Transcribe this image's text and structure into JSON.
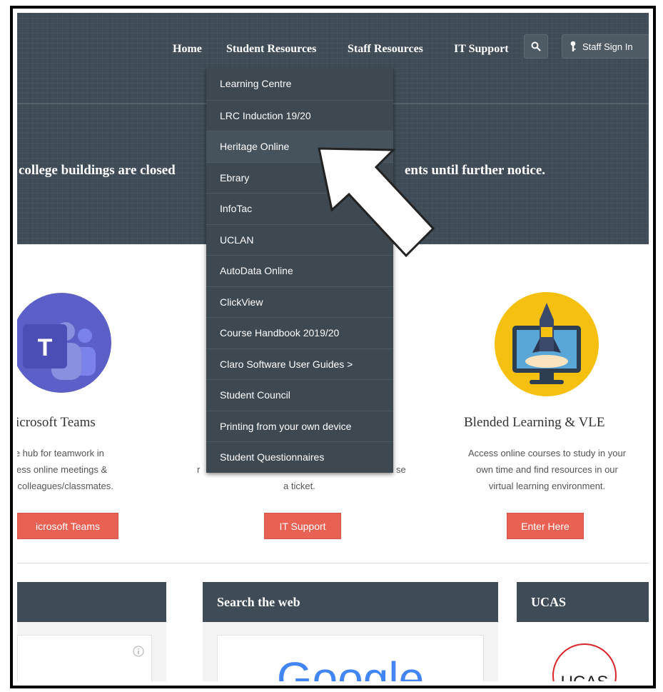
{
  "nav": {
    "items": [
      "Home",
      "Student Resources",
      "Staff Resources",
      "IT Support"
    ],
    "signin_label": "Staff Sign In"
  },
  "hero": {
    "notice_left": "college buildings are closed",
    "notice_right": "ents until further notice."
  },
  "dropdown": {
    "items": [
      "Learning Centre",
      "LRC Induction 19/20",
      "Heritage Online",
      "Ebrary",
      "InfoTac",
      "UCLAN",
      "AutoData Online",
      "ClickView",
      "Course Handbook 2019/20",
      "Claro Software User Guides >",
      "Student Council",
      "Printing from your own device",
      "Student Questionnaires"
    ],
    "highlighted_index": 2
  },
  "cards": {
    "teams": {
      "title": "icrosoft Teams",
      "lines": [
        "the hub for teamwork in",
        "ccess online meetings &",
        "th colleagues/classmates."
      ],
      "button": "icrosoft Teams",
      "icon_letter": "T"
    },
    "it": {
      "line_suffix": "se",
      "line2": "a ticket.",
      "line_prefix": "r",
      "button": "IT Support"
    },
    "vle": {
      "title": "Blended Learning & VLE",
      "lines": [
        "Access online courses to study in your",
        "own time and find resources in our",
        "virtual learning environment."
      ],
      "button": "Enter Here"
    }
  },
  "panels": {
    "search_title": "Search the web",
    "ucas_title": "UCAS",
    "google_logo": "Google",
    "ucas_logo": "UCAS"
  },
  "colors": {
    "header_bg": "#3f4b56",
    "dropdown_bg": "#3d4851",
    "button_red": "#e86153",
    "teams_purple": "#5b5fc7",
    "vle_yellow": "#f5c010"
  }
}
